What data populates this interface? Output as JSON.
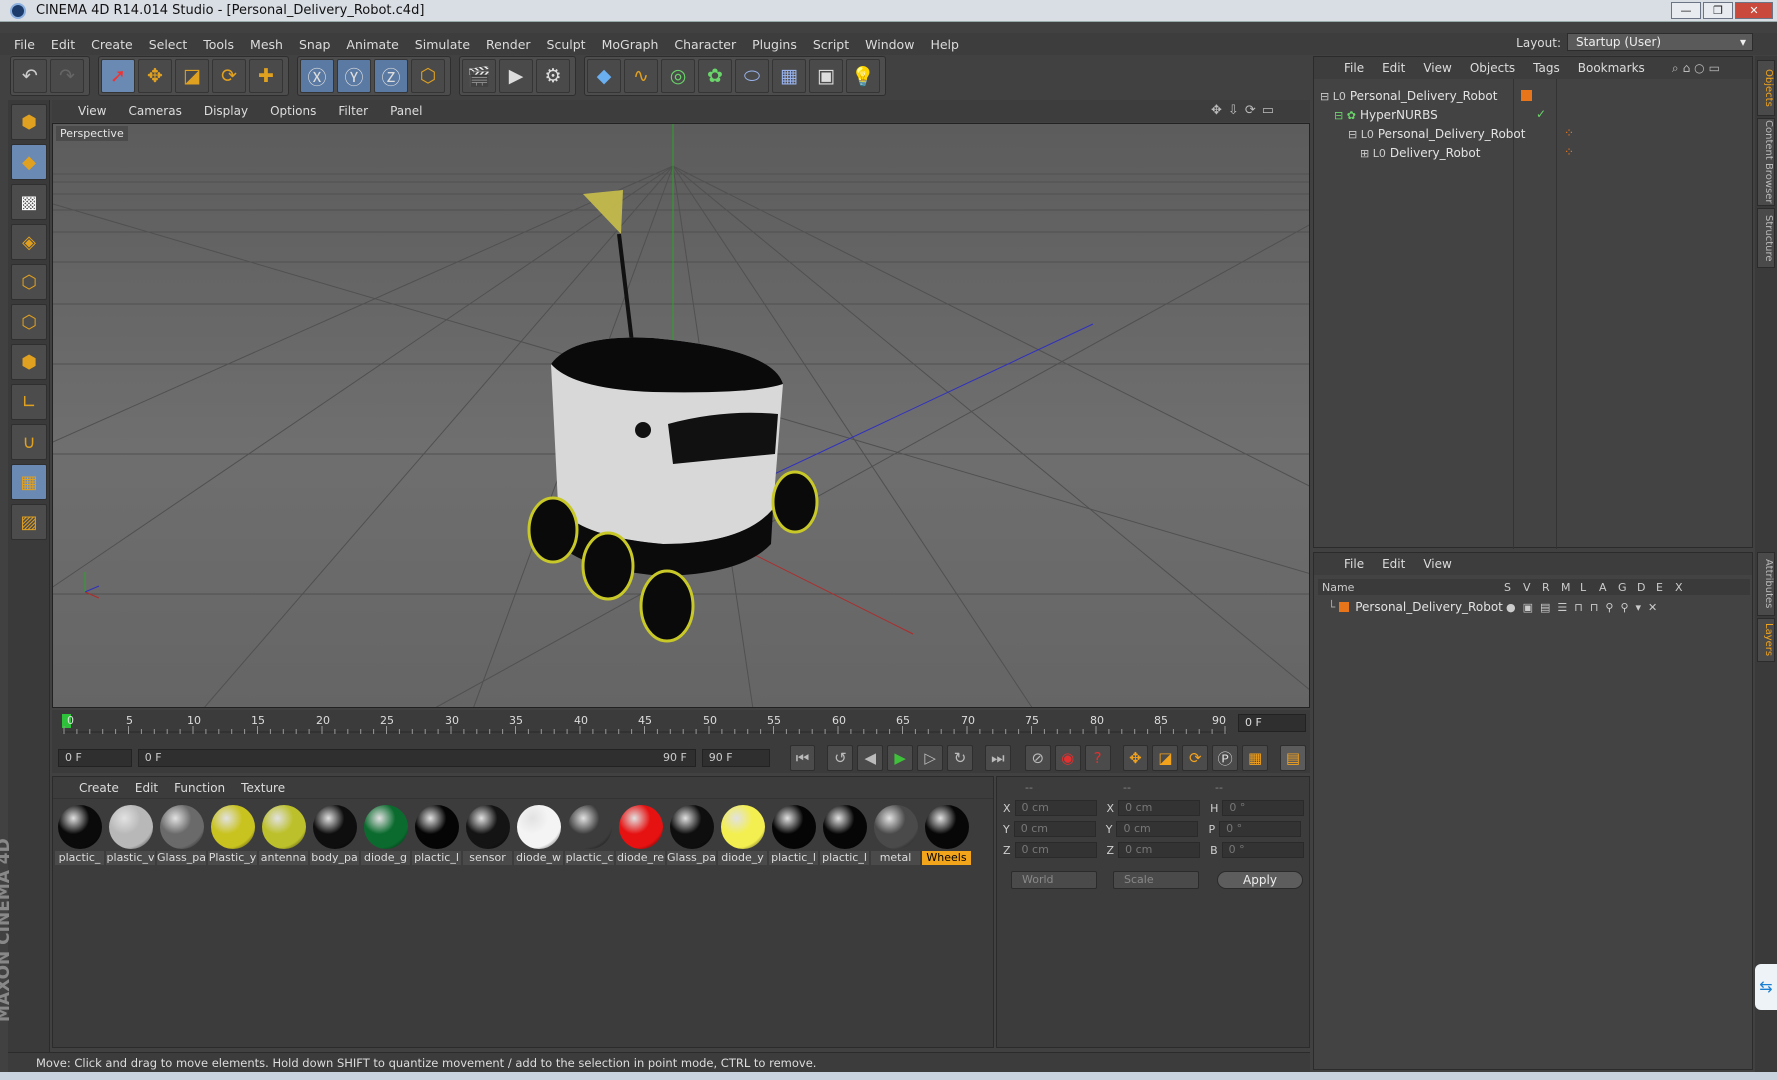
{
  "window": {
    "title": "CINEMA 4D R14.014 Studio - [Personal_Delivery_Robot.c4d]"
  },
  "menu": [
    "File",
    "Edit",
    "Create",
    "Select",
    "Tools",
    "Mesh",
    "Snap",
    "Animate",
    "Simulate",
    "Render",
    "Sculpt",
    "MoGraph",
    "Character",
    "Plugins",
    "Script",
    "Window",
    "Help"
  ],
  "layout": {
    "label": "Layout:",
    "value": "Startup (User)"
  },
  "viewport": {
    "menu": [
      "View",
      "Cameras",
      "Display",
      "Options",
      "Filter",
      "Panel"
    ],
    "label": "Perspective"
  },
  "timeline": {
    "ticks": [
      "0",
      "5",
      "10",
      "15",
      "20",
      "25",
      "30",
      "35",
      "40",
      "45",
      "50",
      "55",
      "60",
      "65",
      "70",
      "75",
      "80",
      "85",
      "90"
    ],
    "end_field": "0 F"
  },
  "controls": {
    "start": "0 F",
    "range_start": "0 F",
    "range_end": "90 F",
    "end": "90 F"
  },
  "materials": {
    "menu": [
      "Create",
      "Edit",
      "Function",
      "Texture"
    ],
    "items": [
      {
        "name": "plactic_",
        "color": "#0a0a0a"
      },
      {
        "name": "plastic_v",
        "color": "#b8b8b8"
      },
      {
        "name": "Glass_pa",
        "color": "#6a6a6a"
      },
      {
        "name": "Plastic_y",
        "color": "#c9c320"
      },
      {
        "name": "antenna",
        "color": "#bcc02a"
      },
      {
        "name": "body_pa",
        "color": "#0e0e0e"
      },
      {
        "name": "diode_g",
        "color": "#0b6b2e"
      },
      {
        "name": "plactic_l",
        "color": "#050505"
      },
      {
        "name": "sensor",
        "color": "#141414"
      },
      {
        "name": "diode_w",
        "color": "#f4f4f4"
      },
      {
        "name": "plactic_c",
        "color": "#3c3c3c"
      },
      {
        "name": "diode_re",
        "color": "#e61111"
      },
      {
        "name": "Glass_pa",
        "color": "#0e0e0e"
      },
      {
        "name": "diode_y",
        "color": "#f3ef50"
      },
      {
        "name": "plactic_l",
        "color": "#050505"
      },
      {
        "name": "plactic_l",
        "color": "#060606"
      },
      {
        "name": "metal",
        "color": "#4a4a4a"
      },
      {
        "name": "Wheels",
        "color": "#070707"
      }
    ]
  },
  "coords": {
    "headers": [
      "--",
      "--",
      "--"
    ],
    "rows": [
      {
        "a": "X",
        "av": "0 cm",
        "b": "X",
        "bv": "0 cm",
        "c": "H",
        "cv": "0 °"
      },
      {
        "a": "Y",
        "av": "0 cm",
        "b": "Y",
        "bv": "0 cm",
        "c": "P",
        "cv": "0 °"
      },
      {
        "a": "Z",
        "av": "0 cm",
        "b": "Z",
        "bv": "0 cm",
        "c": "B",
        "cv": "0 °"
      }
    ],
    "mode": "World",
    "scale": "Scale",
    "apply": "Apply"
  },
  "objects": {
    "menu": [
      "File",
      "Edit",
      "View",
      "Objects",
      "Tags",
      "Bookmarks"
    ],
    "items": [
      "Personal_Delivery_Robot",
      "HyperNURBS",
      "Personal_Delivery_Robot",
      "Delivery_Robot"
    ]
  },
  "layers": {
    "menu": [
      "File",
      "Edit",
      "View"
    ],
    "columns": [
      "Name",
      "S",
      "V",
      "R",
      "M",
      "L",
      "A",
      "G",
      "D",
      "E",
      "X"
    ],
    "item": "Personal_Delivery_Robot"
  },
  "sidetabs": [
    "Objects",
    "Content Browser",
    "Structure",
    "Attributes",
    "Layers"
  ],
  "status": "Move: Click and drag to move elements. Hold down SHIFT to quantize movement / add to the selection in point mode, CTRL to remove.",
  "brand": "MAXON CINEMA 4D",
  "colors": {
    "accent": "#f2a41b",
    "selection": "#6a8ab3"
  }
}
